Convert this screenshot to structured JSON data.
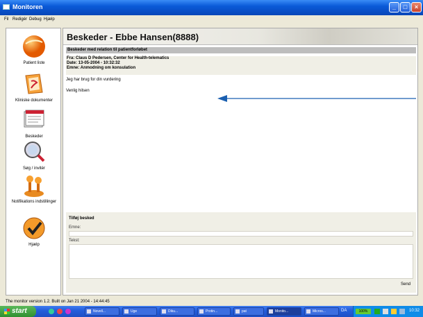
{
  "window": {
    "title": "Monitoren",
    "controls": {
      "minimize": "_",
      "maximize": "□",
      "close": "×"
    }
  },
  "menu": {
    "items": [
      "Fil",
      "Redigér",
      "Debug",
      "Hjælp"
    ]
  },
  "nav": {
    "items": [
      {
        "label": "Patient liste",
        "icon": "orange-sphere-icon"
      },
      {
        "label": "Kliniske dokumenter",
        "icon": "folder-documents-icon"
      },
      {
        "label": "Beskeder",
        "icon": "message-papers-icon"
      },
      {
        "label": "Søg / invitér",
        "icon": "magnifier-icon"
      },
      {
        "label": "Notifikations indstillinger",
        "icon": "joystick-icon"
      },
      {
        "label": "Hjælp",
        "icon": "help-check-icon"
      }
    ]
  },
  "main": {
    "title": "Beskeder - Ebbe Hansen(8888)",
    "section_title": "Beskeder med relation til patientforløbet",
    "message": {
      "from": "Fra: Claus D Pedersen, Center for Health-telematics",
      "date": "Date: 13-05-2004 - 10:32:32",
      "subject": "Emne: Anmodning om konsulation",
      "body_line1": "Jeg har brug for din vurdering",
      "body_line2": "Venlig hilsen"
    },
    "reply": {
      "title": "Tilføj besked",
      "subject_label": "Emne:",
      "text_label": "Tekst:",
      "subject_value": "",
      "text_value": "",
      "send_label": "Send"
    }
  },
  "status": {
    "text": "The monitor version 1.2. Built on Jan 21 2004 - 14:44:45"
  },
  "taskbar": {
    "start_label": "start",
    "tasks": [
      {
        "label": "Novell..."
      },
      {
        "label": "Uge"
      },
      {
        "label": "Diku..."
      },
      {
        "label": "Protin..."
      },
      {
        "label": "pat"
      },
      {
        "label": "Monito..."
      },
      {
        "label": "Micros..."
      }
    ],
    "language": "DA",
    "battery": "100%",
    "clock": "10:32"
  },
  "colors": {
    "titlebar": "#0a5ad8",
    "taskbar": "#245edb",
    "start": "#3c9a3c",
    "arrow": "#1a5fb0"
  }
}
